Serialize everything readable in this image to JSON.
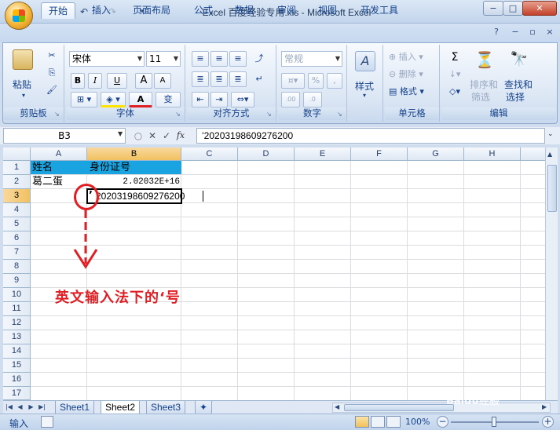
{
  "window": {
    "title": "Excel 百度经验专用.xls - Microsoft Excel",
    "minimize": "−",
    "maximize": "□",
    "close": "✕"
  },
  "quick_access": {
    "save": "💾",
    "undo": "↶",
    "redo": "↷"
  },
  "tabs": [
    "开始",
    "插入",
    "页面布局",
    "公式",
    "数据",
    "审阅",
    "视图",
    "开发工具"
  ],
  "ribbon": {
    "clipboard": {
      "label": "剪贴板",
      "paste": "粘贴"
    },
    "font": {
      "label": "字体",
      "font_name": "宋体",
      "font_size": "11",
      "bold": "B",
      "italic": "I",
      "underline": "U",
      "grow": "A",
      "shrink": "A",
      "color": "A",
      "wen": "变"
    },
    "alignment": {
      "label": "对齐方式"
    },
    "number": {
      "label": "数字",
      "format": "常规",
      "percent": "%",
      "comma": ","
    },
    "styles": {
      "label": "样式"
    },
    "cells": {
      "label": "单元格",
      "insert": "插入",
      "delete": "删除",
      "format": "格式"
    },
    "editing": {
      "label": "编辑",
      "sort_filter": "排序和",
      "sort_filter2": "筛选",
      "find_select": "查找和",
      "find_select2": "选择",
      "sigma": "Σ"
    }
  },
  "formula_bar": {
    "name_box": "B3",
    "formula": "’20203198609276200",
    "fx": "fx"
  },
  "columns": [
    "A",
    "B",
    "C",
    "D",
    "E",
    "F",
    "G",
    "H"
  ],
  "rows": [
    "1",
    "2",
    "3",
    "4",
    "5",
    "6",
    "7",
    "8",
    "9",
    "10",
    "11",
    "12",
    "13",
    "14",
    "15",
    "16",
    "17"
  ],
  "cells": {
    "A1": "姓名",
    "B1": "身份证号",
    "A2": "葛二蛋",
    "B2": "2.02032E+16",
    "B3_quote": "’",
    "B3": "20203198609276200"
  },
  "annotation": "英文输入法下的‘号",
  "sheets": [
    "Sheet1",
    "Sheet2",
    "Sheet3"
  ],
  "status": {
    "mode": "输入",
    "zoom": "100%"
  },
  "watermark": "Baidu经验",
  "colors": {
    "header_fill": "#1aa3e1",
    "annotation": "#e01f25"
  }
}
